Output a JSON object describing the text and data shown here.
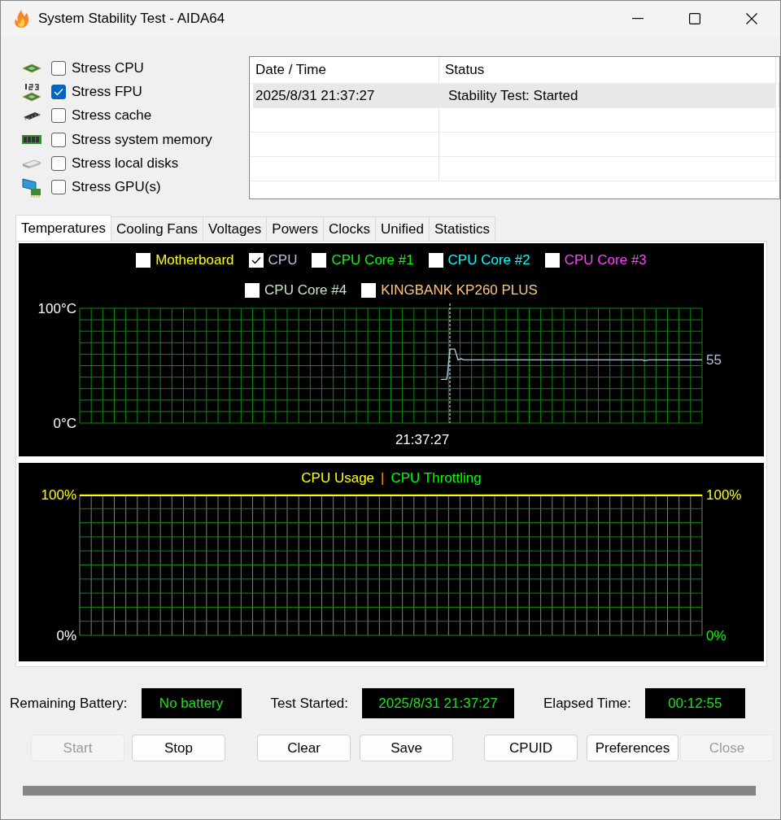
{
  "window": {
    "title": "System Stability Test - AIDA64"
  },
  "stress_options": [
    {
      "label": "Stress CPU",
      "checked": false
    },
    {
      "label": "Stress FPU",
      "checked": true
    },
    {
      "label": "Stress cache",
      "checked": false
    },
    {
      "label": "Stress system memory",
      "checked": false
    },
    {
      "label": "Stress local disks",
      "checked": false
    },
    {
      "label": "Stress GPU(s)",
      "checked": false
    }
  ],
  "log": {
    "columns": [
      "Date / Time",
      "Status"
    ],
    "rows": [
      {
        "cells": [
          "2025/8/31 21:37:27",
          "Stability Test: Started"
        ],
        "selected": true
      }
    ]
  },
  "tabs": [
    {
      "label": "Temperatures",
      "selected": true
    },
    {
      "label": "Cooling Fans",
      "selected": false
    },
    {
      "label": "Voltages",
      "selected": false
    },
    {
      "label": "Powers",
      "selected": false
    },
    {
      "label": "Clocks",
      "selected": false
    },
    {
      "label": "Unified",
      "selected": false
    },
    {
      "label": "Statistics",
      "selected": false
    }
  ],
  "temperature_graph": {
    "kind": "temperature",
    "legend": [
      {
        "label": "Motherboard",
        "checked": false,
        "color": "#ffff00"
      },
      {
        "label": "CPU",
        "checked": true,
        "color": "#b0c4de"
      },
      {
        "label": "CPU Core #1",
        "checked": false,
        "color": "#00ff00"
      },
      {
        "label": "CPU Core #2",
        "checked": false,
        "color": "#00ffff"
      },
      {
        "label": "CPU Core #3",
        "checked": false,
        "color": "#ff40ff"
      },
      {
        "label": "CPU Core #4",
        "checked": false,
        "color": "#c8e6c8"
      },
      {
        "label": "KINGBANK KP260 PLUS",
        "checked": false,
        "color": "#ffc880"
      }
    ],
    "left_axis_labels": [
      {
        "label": "100°C",
        "color": "#ffffff"
      },
      {
        "label": "0°C",
        "color": "#ffffff"
      }
    ],
    "time_label": "21:37:27",
    "reading": "55"
  },
  "usage_graph": {
    "kind": "usage",
    "legend": [
      {
        "label": "CPU Usage",
        "color": "#ffff00"
      },
      {
        "label": "CPU Throttling",
        "color": "#00ff00"
      }
    ],
    "separator": "|",
    "left_axis_labels": [
      {
        "label": "100%",
        "color": "#ffff00"
      },
      {
        "label": "0%",
        "color": "#ffffff"
      }
    ],
    "right_axis_labels": [
      {
        "label": "100%",
        "color": "#ffff00"
      },
      {
        "label": "0%",
        "color": "#00ff00"
      }
    ]
  },
  "status": [
    {
      "label": "Remaining Battery:",
      "value": "No battery"
    },
    {
      "label": "Test Started:",
      "value": "2025/8/31 21:37:27"
    },
    {
      "label": "Elapsed Time:",
      "value": "00:12:55"
    }
  ],
  "buttons": [
    {
      "label": "Start",
      "disabled": true
    },
    {
      "label": "Stop",
      "disabled": false
    },
    {
      "label": "Clear",
      "disabled": false
    },
    {
      "label": "Save",
      "disabled": false
    },
    {
      "label": "CPUID",
      "disabled": false
    },
    {
      "label": "Preferences",
      "disabled": false
    },
    {
      "label": "Close",
      "disabled": true
    }
  ]
}
